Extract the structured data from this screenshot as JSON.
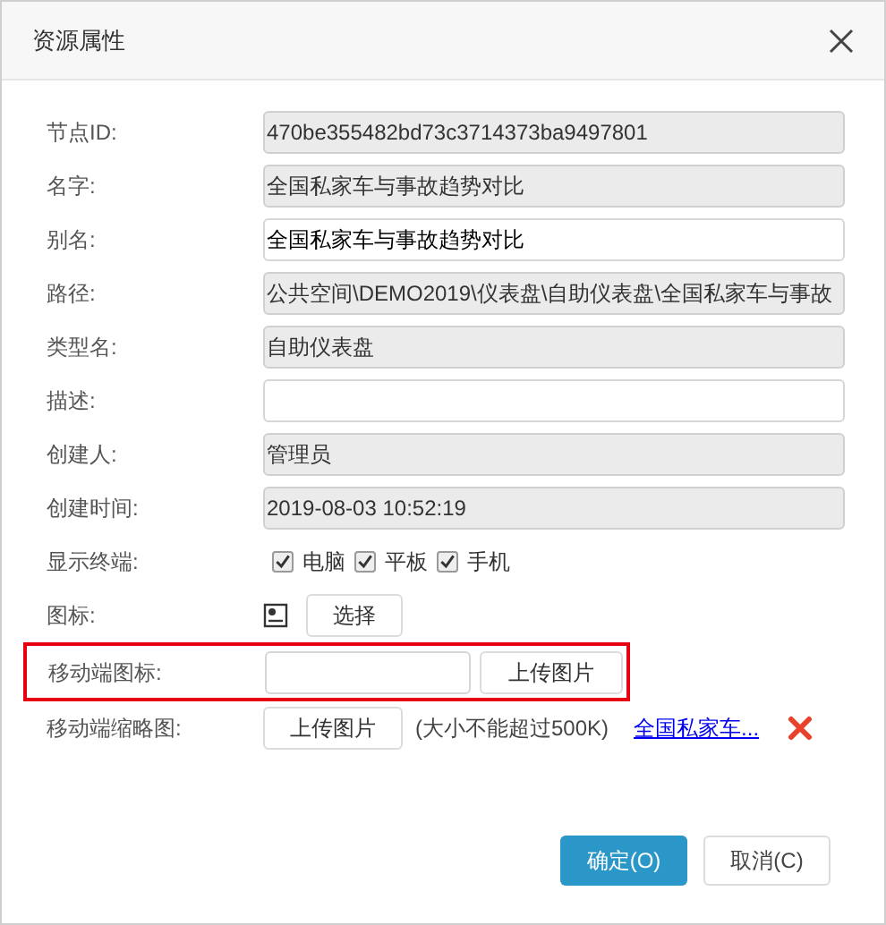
{
  "window": {
    "title": "资源属性"
  },
  "fields": [
    {
      "label": "节点ID:",
      "value": "470be355482bd73c3714373ba9497801",
      "readonly": true
    },
    {
      "label": "名字:",
      "value": "全国私家车与事故趋势对比",
      "readonly": true
    },
    {
      "label": "别名:",
      "value": "全国私家车与事故趋势对比",
      "readonly": false
    },
    {
      "label": "路径:",
      "value": "公共空间\\DEMO2019\\仪表盘\\自助仪表盘\\全国私家车与事故",
      "readonly": true
    },
    {
      "label": "类型名:",
      "value": "自助仪表盘",
      "readonly": true
    },
    {
      "label": "描述:",
      "readonly": false
    },
    {
      "label": "创建人:",
      "value": "管理员",
      "readonly": true
    },
    {
      "label": "创建时间:",
      "value": "2019-08-03 10:52:19",
      "readonly": true
    }
  ],
  "terminals": {
    "label": "显示终端:",
    "options": [
      {
        "label": "电脑",
        "checked": true
      },
      {
        "label": "平板",
        "checked": true
      },
      {
        "label": "手机",
        "checked": true
      }
    ]
  },
  "icon_row": {
    "label": "图标:",
    "button": "选择"
  },
  "mobile_icon": {
    "label": "移动端图标:",
    "button": "上传图片",
    "highlighted": true
  },
  "thumbnail": {
    "label": "移动端缩略图:",
    "button": "上传图片",
    "note": "(大小不能超过500K)",
    "link": "全国私家车..."
  },
  "buttons": [
    {
      "label": "确定(O)",
      "kind": "primary"
    },
    {
      "label": "取消(C)",
      "kind": "secondary"
    }
  ]
}
